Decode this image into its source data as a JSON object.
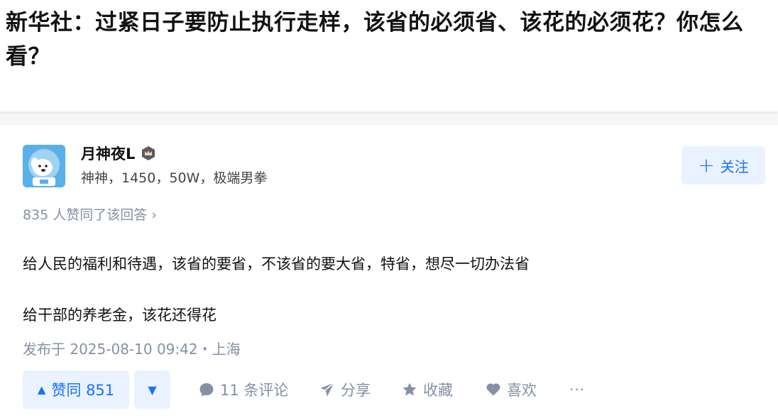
{
  "question": {
    "title": "新华社：过紧日子要防止执行走样，该省的必须省、该花的必须花？你怎么看？"
  },
  "author": {
    "name": "月神夜L",
    "bio": "神神，1450，50W，极端男拳",
    "follow_label": "关注",
    "avatar_icon": "astronaut-dog-avatar",
    "badge_icon": "crown-badge-icon"
  },
  "answer": {
    "voters_text": "835 人赞同了该回答",
    "paragraphs": [
      "给人民的福利和待遇，该省的要省，不该省的要大省，特省，想尽一切办法省",
      "给干部的养老金，该花还得花"
    ],
    "publish_time": "发布于 2025-08-10 09:42・上海"
  },
  "actions": {
    "vote_up_label": "赞同 851",
    "comments_label": "11 条评论",
    "share_label": "分享",
    "collect_label": "收藏",
    "like_label": "喜欢",
    "more_label": "···"
  },
  "colors": {
    "accent": "#1772f6",
    "accent_bg": "#eaf2ff",
    "muted": "#8590a6"
  }
}
